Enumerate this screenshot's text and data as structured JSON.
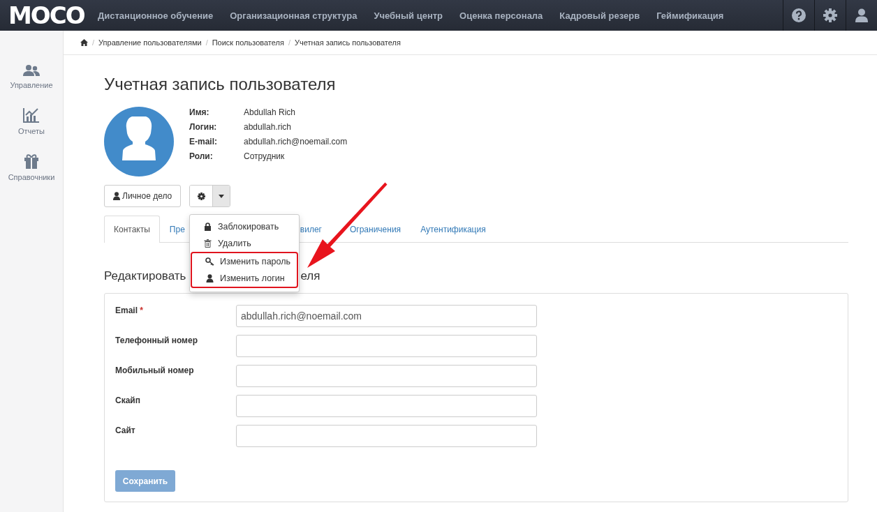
{
  "logo": "MOCO",
  "nav": [
    "Дистанционное обучение",
    "Организационная структура",
    "Учебный центр",
    "Оценка персонала",
    "Кадровый резерв",
    "Геймификация"
  ],
  "sidebar": [
    {
      "label": "Управление",
      "kind": "users"
    },
    {
      "label": "Отчеты",
      "kind": "chart"
    },
    {
      "label": "Справочники",
      "kind": "gift"
    }
  ],
  "breadcrumb_separator": "/",
  "breadcrumb": [
    "Управление пользователями",
    "Поиск пользователя",
    "Учетная запись пользователя"
  ],
  "title": "Учетная запись пользователя",
  "profile": [
    {
      "label": "Имя:",
      "value": "Abdullah Rich"
    },
    {
      "label": "Логин:",
      "value": "abdullah.rich"
    },
    {
      "label": "E-mail:",
      "value": "abdullah.rich@noemail.com"
    },
    {
      "label": "Роли:",
      "value": "Сотрудник"
    }
  ],
  "personal_file_button": "Личное дело",
  "tabs": [
    {
      "label": "Контакты",
      "selected": true
    },
    {
      "label": "Пре",
      "selected": false
    },
    {
      "label": "вилег",
      "selected": false
    },
    {
      "label": "Ограничения",
      "selected": false
    },
    {
      "label": "Аутентификация",
      "selected": false
    }
  ],
  "menu": {
    "items": [
      {
        "label": "Заблокировать",
        "kind": "lock"
      },
      {
        "label": "Удалить",
        "kind": "trash"
      }
    ],
    "highlighted_items": [
      {
        "label": "Изменить пароль",
        "kind": "key"
      },
      {
        "label": "Изменить логин",
        "kind": "user"
      }
    ]
  },
  "section_title": [
    "Редактировать",
    "еля"
  ],
  "form": {
    "fields": [
      {
        "label": "Email",
        "required": true,
        "value": "abdullah.rich@noemail.com"
      },
      {
        "label": "Телефонный номер",
        "required": false
      },
      {
        "label": "Мобильный номер",
        "required": false
      },
      {
        "label": "Скайп",
        "required": false
      },
      {
        "label": "Сайт",
        "required": false
      }
    ],
    "required_mark": "*",
    "save_button": {
      "label": "Сохранить",
      "disabled": true
    }
  }
}
